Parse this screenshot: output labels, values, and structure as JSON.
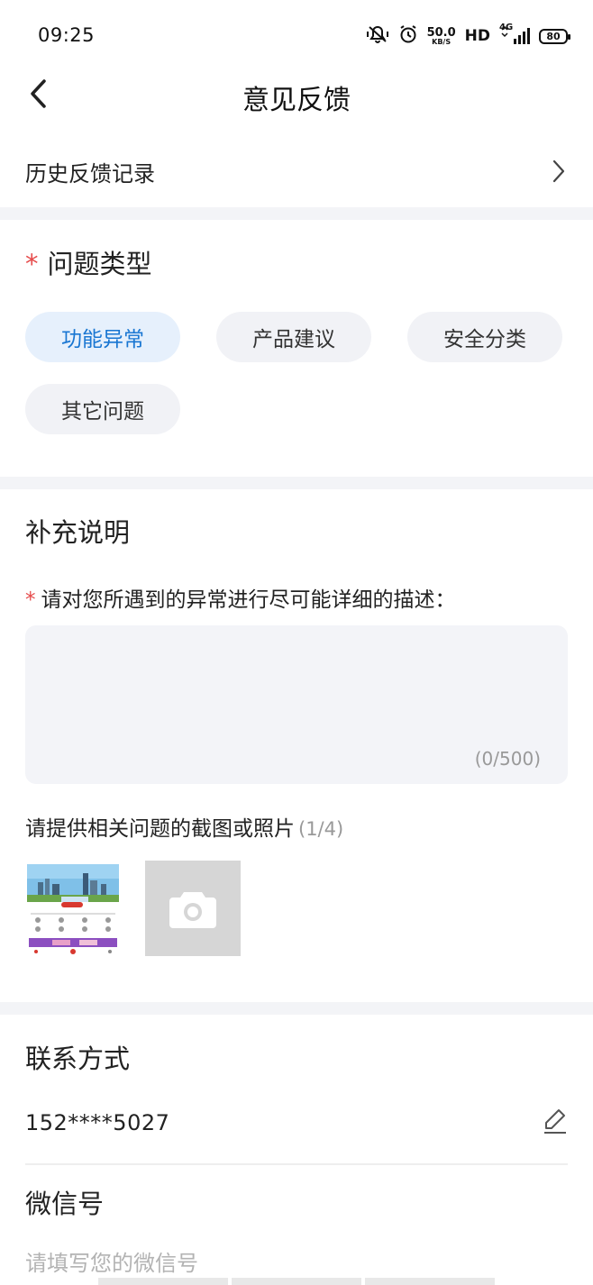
{
  "status_bar": {
    "time": "09:25",
    "speed_value": "50.0",
    "speed_unit": "KB/S",
    "hd": "HD",
    "network": "4G",
    "battery": "80",
    "icons": [
      "mute-icon",
      "alarm-icon",
      "signal-icon"
    ]
  },
  "nav": {
    "title": "意见反馈"
  },
  "history": {
    "label": "历史反馈记录"
  },
  "problem_type": {
    "required_mark": "*",
    "title": "问题类型",
    "options": [
      "功能异常",
      "产品建议",
      "安全分类",
      "其它问题"
    ],
    "selected": "功能异常"
  },
  "supplement": {
    "title": "补充说明",
    "required_mark": "*",
    "description_label": "请对您所遇到的异常进行尽可能详细的描述：",
    "textarea_value": "",
    "counter": "(0/500)",
    "upload_label": "请提供相关问题的截图或照片",
    "upload_count": "(1/4)"
  },
  "contact": {
    "title": "联系方式",
    "phone": "152****5027"
  },
  "wechat": {
    "title": "微信号",
    "placeholder": "请填写您的微信号"
  },
  "colors": {
    "accent": "#1976d2",
    "chip_active_bg": "#e6f0fc",
    "required": "#e64b4b",
    "section_gap": "#f3f4f7"
  }
}
